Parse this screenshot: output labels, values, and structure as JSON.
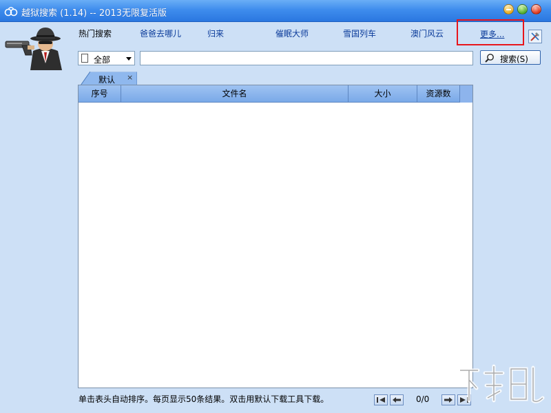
{
  "window": {
    "title": "越狱搜索 (1.14) -- 2013无限复活版"
  },
  "hot_search": {
    "label": "热门搜索",
    "items": [
      "爸爸去哪儿",
      "归来",
      "催眠大师",
      "雪国列车",
      "澳门风云"
    ],
    "more": "更多..."
  },
  "search": {
    "scope_value": "全部",
    "query_value": "",
    "button_label": "搜索(S)"
  },
  "tabs": [
    {
      "label": "默认",
      "close": "×"
    }
  ],
  "table": {
    "columns": [
      "序号",
      "文件名",
      "大小",
      "资源数"
    ],
    "rows": []
  },
  "footer": {
    "hint": "单击表头自动排序。每页显示50条结果。双击用默认下载工具下载。",
    "page_info": "0/0"
  },
  "colors": {
    "titlebar": "#3f8ded",
    "background": "#cde0f6",
    "link": "#0b3b9a",
    "highlight_box": "#e8141a",
    "header": "#8db4ec"
  }
}
